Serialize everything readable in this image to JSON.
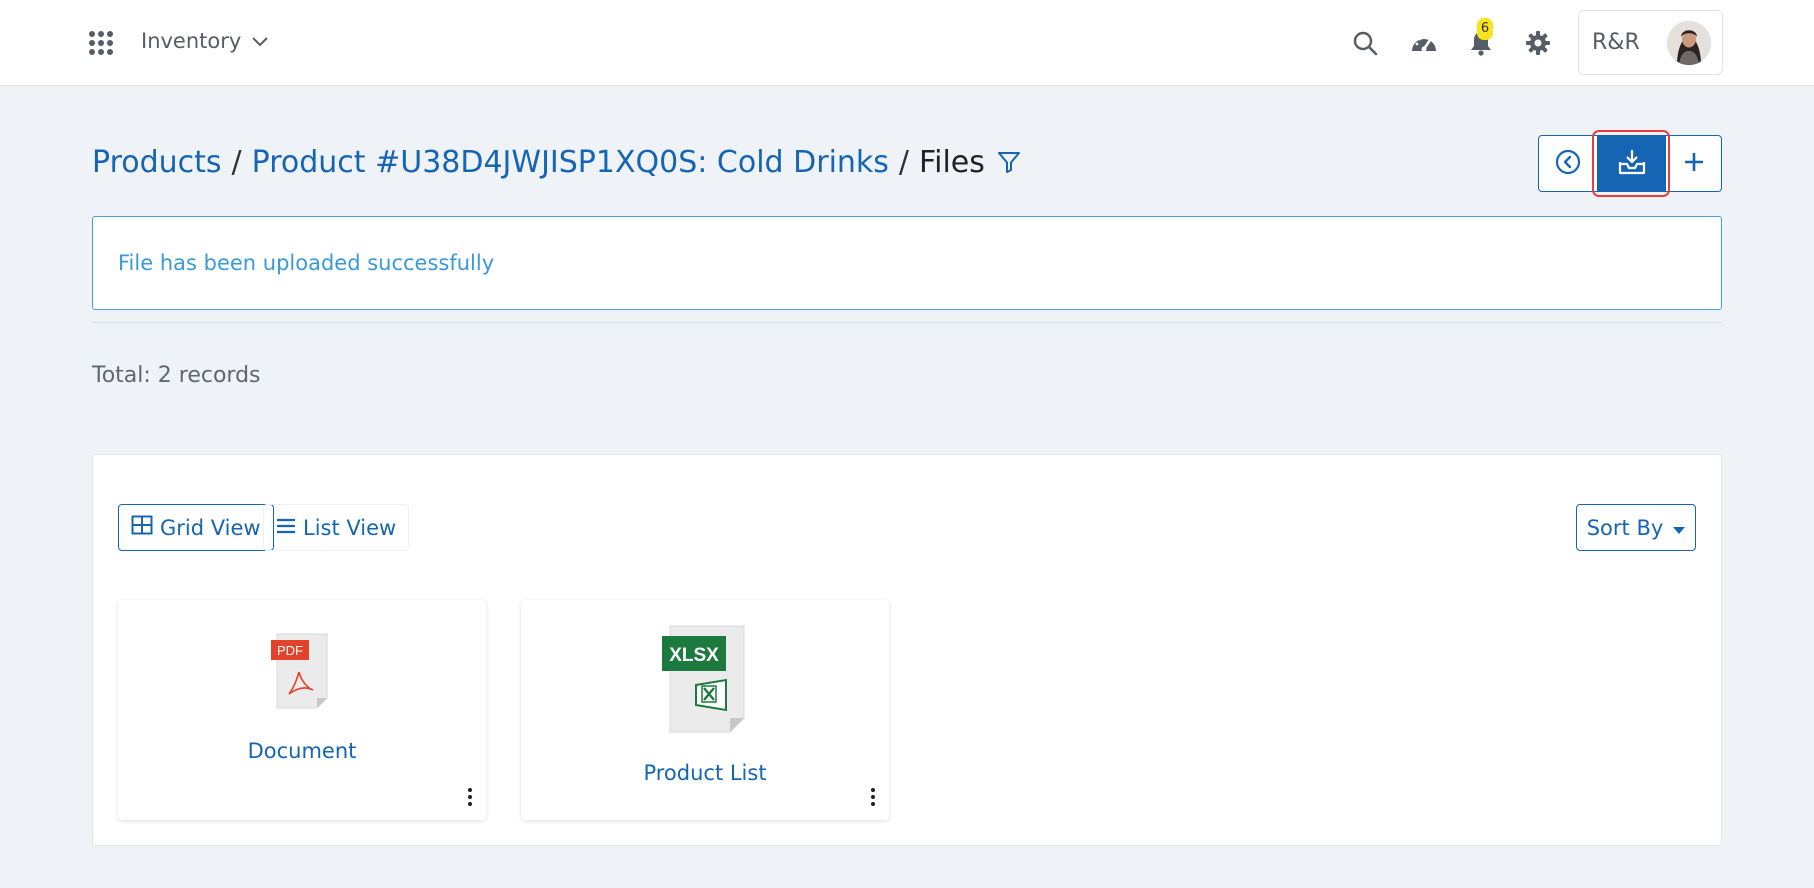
{
  "navbar": {
    "app_name": "Inventory",
    "notification_count": "6",
    "user_initials": "R&R"
  },
  "breadcrumb": {
    "items": [
      "Products",
      "Product #U38D4JWJISP1XQ0S: Cold Drinks"
    ],
    "separator": "/",
    "current": "Files"
  },
  "alert": {
    "message": "File has been uploaded successfully"
  },
  "summary": {
    "total": "Total: 2 records"
  },
  "toolbar": {
    "grid_view": "Grid View",
    "list_view": "List View",
    "sort_by": "Sort By"
  },
  "files": [
    {
      "name": "Document",
      "type_label": "PDF",
      "icon": "pdf-file-icon"
    },
    {
      "name": "Product List",
      "type_label": "XLSX",
      "icon": "xlsx-file-icon"
    }
  ],
  "colors": {
    "primary": "#1565b4",
    "alert_border": "#4a9fd8",
    "alert_text": "#3a9ad9",
    "highlight": "#e53e3e",
    "badge": "#f7e41c",
    "pdf_red": "#e2432a",
    "excel_green": "#1d7a3e"
  }
}
